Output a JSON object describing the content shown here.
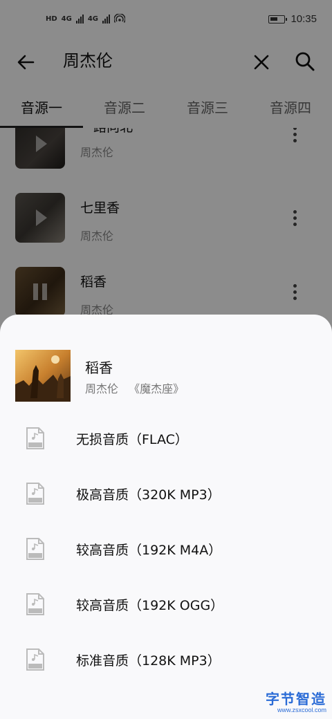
{
  "status_bar": {
    "network_left": "HD",
    "network_1": "4G",
    "network_2": "4G",
    "time": "10:35"
  },
  "toolbar": {
    "search_text": "周杰伦"
  },
  "tabs": [
    {
      "label": "音源一",
      "selected": true
    },
    {
      "label": "音源二",
      "selected": false
    },
    {
      "label": "音源三",
      "selected": false
    },
    {
      "label": "音源四",
      "selected": false
    }
  ],
  "songs": [
    {
      "title": "一路向北",
      "artist": "周杰伦"
    },
    {
      "title": "七里香",
      "artist": "周杰伦"
    },
    {
      "title": "稻香",
      "artist": "周杰伦"
    }
  ],
  "sheet": {
    "song_title": "稻香",
    "artist": "周杰伦",
    "album": "《魔杰座》",
    "qualities": [
      {
        "label": "无损音质（FLAC）",
        "icon": "flac-file-icon",
        "tag": "FLAC"
      },
      {
        "label": "极高音质（320K MP3）",
        "icon": "mp3-file-icon",
        "tag": "MP3"
      },
      {
        "label": "较高音质（192K M4A）",
        "icon": "m4a-file-icon",
        "tag": "M4A"
      },
      {
        "label": "较高音质（192K OGG）",
        "icon": "ogg-file-icon",
        "tag": "OGG"
      },
      {
        "label": "标准音质（128K MP3）",
        "icon": "mp3-file-icon",
        "tag": "MP3"
      }
    ]
  },
  "watermark": {
    "main": "字节智造",
    "sub": "www.zsxcool.com"
  },
  "colors": {
    "scrim": "#000000",
    "sheet_bg": "#f9f9fb",
    "watermark": "#2a6bd6"
  }
}
